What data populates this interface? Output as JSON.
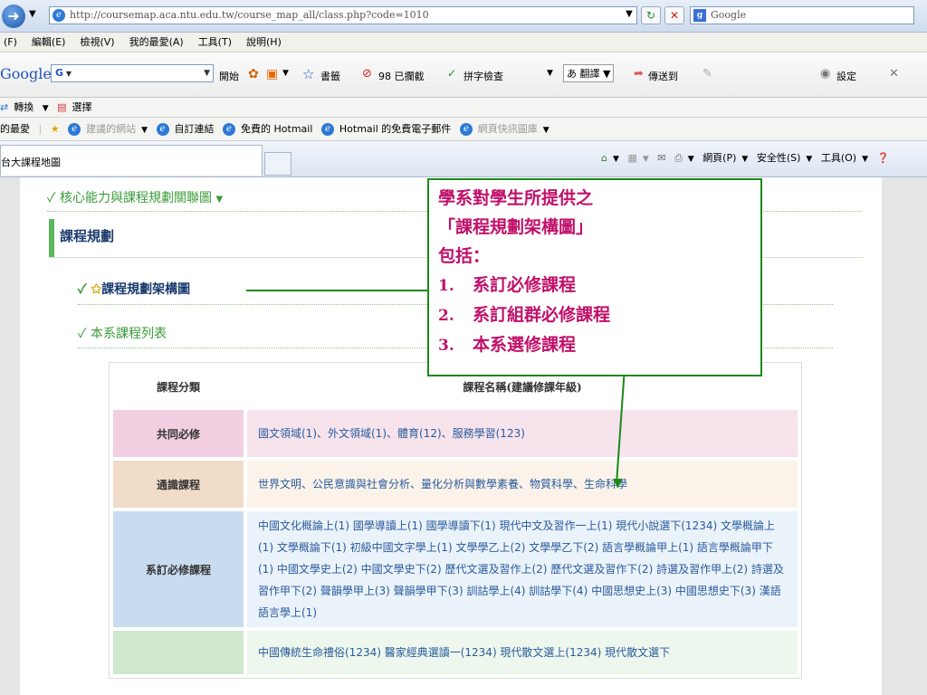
{
  "browser": {
    "url": "http://coursemap.aca.ntu.edu.tw/course_map_all/class.php?code=1010",
    "search_placeholder": "Google",
    "menu": [
      "(F)",
      "編輯(E)",
      "檢視(V)",
      "我的最愛(A)",
      "工具(T)",
      "說明(H)"
    ],
    "google_toolbar": {
      "logo": "Google",
      "g_box": "G",
      "start": "開始",
      "bookmarks": "書籤",
      "blocked": "98 已攔截",
      "spellcheck": "拼字檢查",
      "translate": "翻譯",
      "send_to": "傳送到",
      "settings": "設定"
    },
    "convert": [
      "轉換",
      "選擇"
    ],
    "favorites": {
      "label": "的最愛",
      "items": [
        "建議的網站",
        "自訂連結",
        "免費的 Hotmail",
        "Hotmail 的免費電子郵件",
        "網頁快訊圖庫"
      ]
    },
    "tab_title": "台大課程地圖",
    "command_bar": [
      "網頁(P)",
      "安全性(S)",
      "工具(O)"
    ]
  },
  "page": {
    "core_link": "核心能力與課程規劃關聯圖",
    "section_title": "課程規劃",
    "links": [
      "課程規劃架構圖",
      "本系課程列表"
    ],
    "table": {
      "headers": [
        "課程分類",
        "課程名稱(建議修課年級)"
      ],
      "rows": [
        {
          "category": "共同必修",
          "courses": "國文領域(1)、外文領域(1)、體育(12)、服務學習(123)"
        },
        {
          "category": "通識課程",
          "courses": "世界文明、公民意識與社會分析、量化分析與數學素養、物質科學、生命科學"
        },
        {
          "category": "系訂必修課程",
          "courses": "中國文化概論上(1) 國學導讀上(1) 國學導讀下(1) 現代中文及習作一上(1) 現代小說選下(1234) 文學概論上(1) 文學概論下(1) 初級中國文字學上(1) 文學學乙上(2) 文學學乙下(2) 語言學概論甲上(1) 語言學概論甲下(1) 中國文學史上(2) 中國文學史下(2) 歷代文選及習作上(2) 歷代文選及習作下(2) 詩選及習作甲上(2) 詩選及習作甲下(2) 聲韻學甲上(3) 聲韻學甲下(3) 訓詁學上(4) 訓詁學下(4) 中國思想史上(3) 中國思想史下(3) 漢語語言學上(1)"
        },
        {
          "category": "",
          "courses": "中國傳統生命禮俗(1234) 醫家經典選讀一(1234) 現代散文選上(1234) 現代散文選下"
        }
      ]
    }
  },
  "callout": {
    "lines": [
      "學系對學生所提供之",
      "「課程規劃架構圖」",
      "包括："
    ],
    "items": [
      {
        "num": "1.",
        "text": "系訂必修課程"
      },
      {
        "num": "2.",
        "text": "系訂組群必修課程"
      },
      {
        "num": "3.",
        "text": "本系選修課程"
      }
    ]
  },
  "colors": {
    "callout_text": "#c0106a",
    "callout_border": "#1a8a1a",
    "link_green": "#3a9b3a",
    "course_blue": "#2a5b9c"
  }
}
